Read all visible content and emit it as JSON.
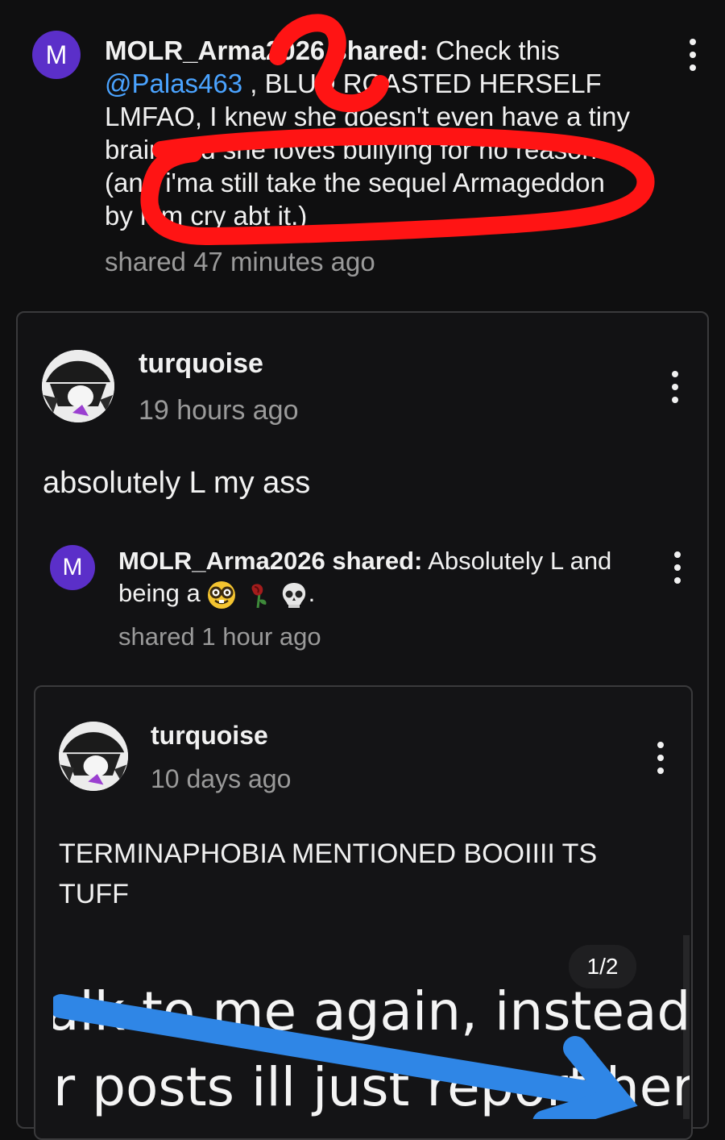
{
  "top_post": {
    "avatar_letter": "M",
    "author": "MOLR_Arma2026",
    "shared_word": "shared:",
    "text_1": " Check this",
    "mention": "@Palas463",
    "text_2": " , BLUD ROASTED HERSELF",
    "line3": "LMFAO, I knew she doesn't even have a tiny",
    "line4": "brain and she loves bullying for no reason",
    "line5": "(and i'ma still take the sequel Armageddon",
    "line6": "by him cry abt it.)",
    "time": "shared 47 minutes ago"
  },
  "comment": {
    "username": "turquoise",
    "time": "19 hours ago",
    "body": "absolutely L my ass"
  },
  "nested_share": {
    "avatar_letter": "M",
    "author": "MOLR_Arma2026",
    "shared_word": "shared:",
    "text": " Absolutely L and",
    "line2": "being a",
    "line2_end": ".",
    "emojis": [
      "nerd-face-emoji",
      "wilted-rose-emoji",
      "skull-emoji"
    ],
    "time": "shared 1 hour ago"
  },
  "inner_post": {
    "username": "turquoise",
    "time": "10 days ago",
    "body_line1": "TERMINAPHOBIA MENTIONED BOOIIII TS",
    "body_line2": "TUFF",
    "image_counter": "1/2",
    "image_text_line1": "alk to me again, instead o",
    "image_text_line2": "r posts ill just report her"
  },
  "colors": {
    "background": "#0f0f10",
    "avatar_purple": "#5b2fc9",
    "mention_blue": "#4aa3ff",
    "annotation_red": "#ff1414",
    "arrow_blue": "#2f86e6"
  }
}
